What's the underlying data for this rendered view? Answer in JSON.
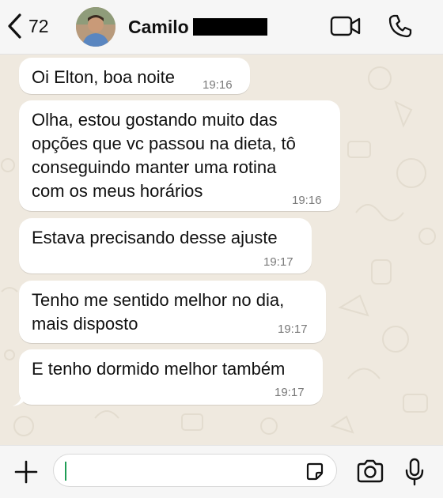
{
  "header": {
    "back_count": "72",
    "contact_name": "Camilo"
  },
  "messages": [
    {
      "lines": [
        "Oi Elton, boa noite"
      ],
      "time": "19:16"
    },
    {
      "lines": [
        "Olha, estou gostando muito das",
        "opções que vc passou na dieta, tô",
        "conseguindo manter uma rotina",
        "com os meus horários"
      ],
      "time": "19:16"
    },
    {
      "lines": [
        "Estava precisando desse ajuste"
      ],
      "time": "19:17"
    },
    {
      "lines": [
        "Tenho me sentido melhor no dia,",
        "mais disposto"
      ],
      "time": "19:17"
    },
    {
      "lines": [
        "E tenho dormido melhor também"
      ],
      "time": "19:17"
    }
  ],
  "composer": {
    "input_value": ""
  },
  "colors": {
    "bubble_incoming": "#ffffff",
    "chat_background": "#efe9df",
    "caret": "#1f9d55"
  },
  "icons": [
    "chevron-left-icon",
    "video-camera-icon",
    "phone-icon",
    "plus-icon",
    "sticker-icon",
    "camera-icon",
    "microphone-icon"
  ]
}
